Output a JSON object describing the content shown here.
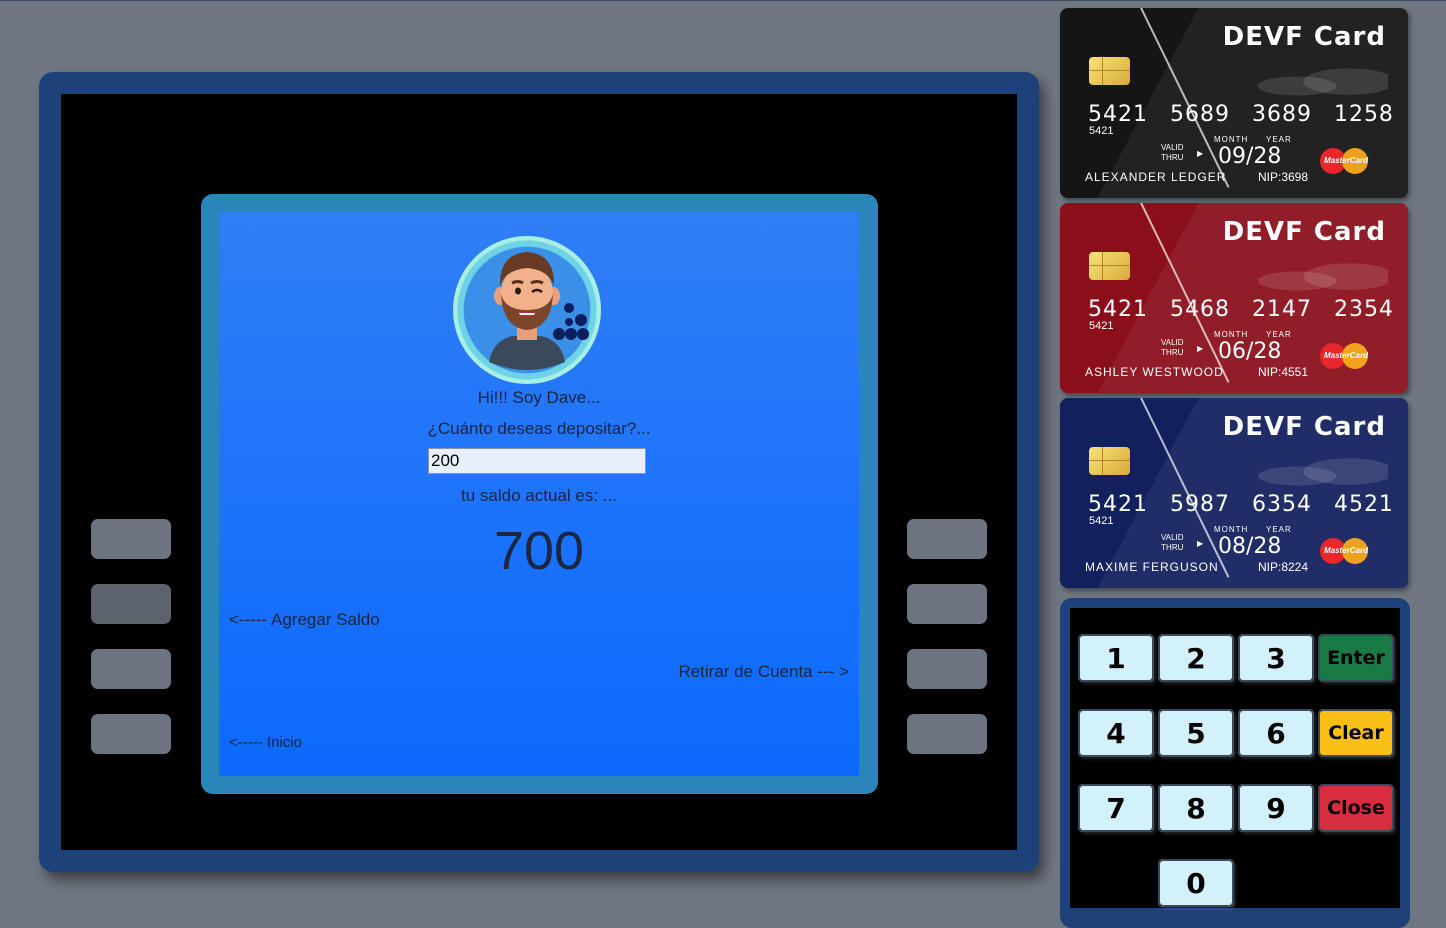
{
  "screen": {
    "greeting": "Hi!!! Soy Dave...",
    "question": "¿Cuánto deseas depositar?...",
    "amount_value": "200",
    "balance_label": "tu saldo actual es: ...",
    "balance": "700",
    "add_link": "<----- Agregar Saldo",
    "withdraw_link": "Retirar de Cuenta --- >",
    "home_link": "<----- Inicio"
  },
  "cards": [
    {
      "title": "DEVF Card",
      "number": "5421 5689 3689 1258",
      "small": "5421",
      "valid": "VALID",
      "thru": "THRU",
      "month": "MONTH",
      "year": "YEAR",
      "expiry": "09/28",
      "holder": "ALEXANDER LEDGER",
      "nip": "NIP:3698",
      "brand": "MasterCard",
      "color": "#151515"
    },
    {
      "title": "DEVF Card",
      "number": "5421 5468 2147 2354",
      "small": "5421",
      "valid": "VALID",
      "thru": "THRU",
      "month": "MONTH",
      "year": "YEAR",
      "expiry": "06/28",
      "holder": "ASHLEY WESTWOOD",
      "nip": "NIP:4551",
      "brand": "MasterCard",
      "color": "#8b0f1b"
    },
    {
      "title": "DEVF Card",
      "number": "5421 5987 6354 4521",
      "small": "5421",
      "valid": "VALID",
      "thru": "THRU",
      "month": "MONTH",
      "year": "YEAR",
      "expiry": "08/28",
      "holder": "MAXIME FERGUSON",
      "nip": "NIP:8224",
      "brand": "MasterCard",
      "color": "#13205e"
    }
  ],
  "keypad": {
    "keys": [
      "1",
      "2",
      "3",
      "4",
      "5",
      "6",
      "7",
      "8",
      "9",
      "0"
    ],
    "enter": "Enter",
    "clear": "Clear",
    "close": "Close"
  },
  "colors": {
    "background": "#6e7681",
    "atm_frame": "#1d4179",
    "screen": "#1c72fb",
    "enter": "#1a7a45",
    "clear": "#f9bf14",
    "close": "#d72d3e"
  }
}
